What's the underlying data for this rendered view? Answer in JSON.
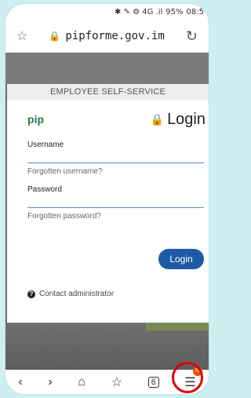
{
  "status": {
    "icons": "✱ ✎ ⚙ 4G .il",
    "battery": "95%",
    "time": "08:5"
  },
  "urlbar": {
    "url": "pipforme.gov.im"
  },
  "card": {
    "header": "EMPLOYEE SELF-SERVICE",
    "logo_a": "p",
    "logo_b": "i",
    "logo_c": "p",
    "title": "Login",
    "username_label": "Username",
    "forgot_username": "Forgotten username?",
    "password_label": "Password",
    "forgot_password": "Forgotten password?",
    "login_button": "Login",
    "contact": "Contact administrator"
  },
  "nav": {
    "badge": "N",
    "tab_count": "6"
  }
}
